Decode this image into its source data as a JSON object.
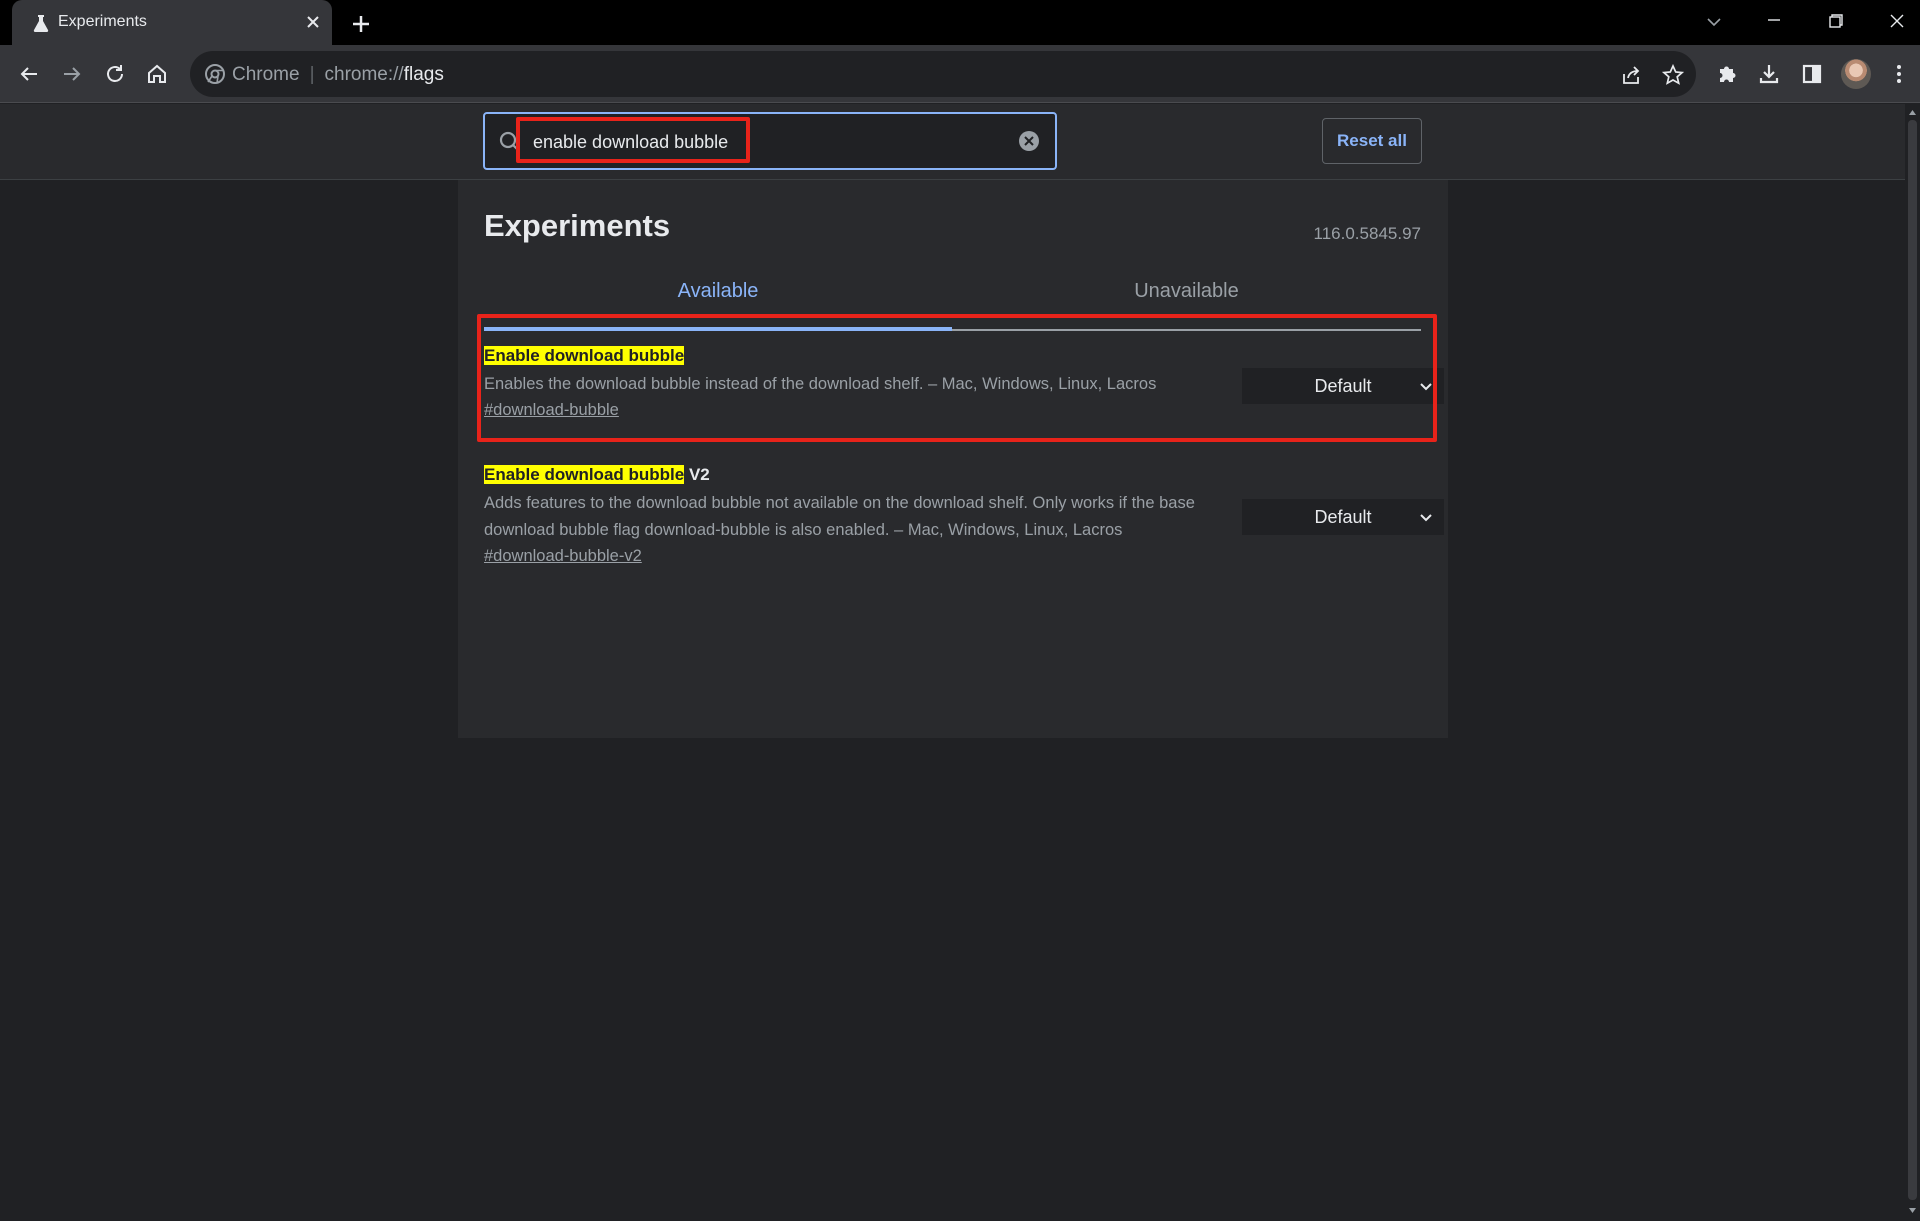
{
  "browser": {
    "tab_title": "Experiments",
    "omnibox": {
      "site_label": "Chrome",
      "url_scheme": "chrome://",
      "url_host": "flags"
    }
  },
  "search": {
    "value": "enable download bubble",
    "reset_label": "Reset all"
  },
  "page": {
    "title": "Experiments",
    "version": "116.0.5845.97",
    "tabs": [
      {
        "label": "Available",
        "active": true
      },
      {
        "label": "Unavailable",
        "active": false
      }
    ]
  },
  "flags": [
    {
      "name_highlight": "Enable download bubble",
      "name_rest": "",
      "description": "Enables the download bubble instead of the download shelf. – Mac, Windows, Linux, Lacros",
      "link": "#download-bubble",
      "selected": "Default"
    },
    {
      "name_highlight": "Enable download bubble",
      "name_rest": " V2",
      "description": "Adds features to the download bubble not available on the download shelf. Only works if the base download bubble flag download-bubble is also enabled. – Mac, Windows, Linux, Lacros",
      "link": "#download-bubble-v2",
      "selected": "Default"
    }
  ],
  "colors": {
    "accent": "#8ab4f8",
    "highlight": "#ffff00",
    "annotation": "#e8231a",
    "background": "#202124"
  }
}
